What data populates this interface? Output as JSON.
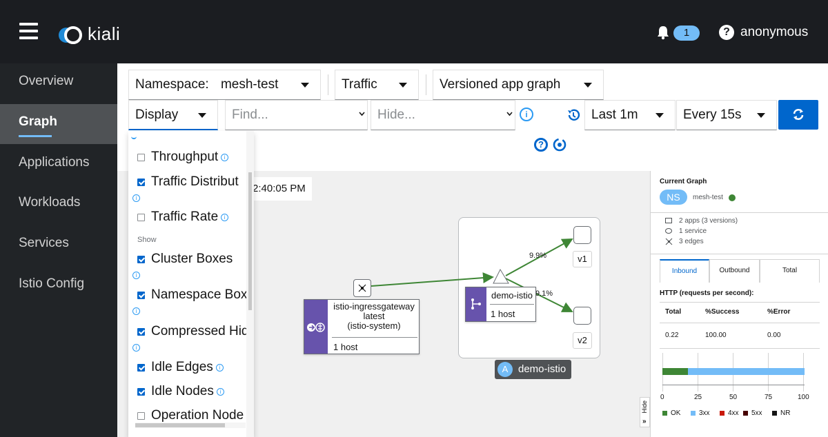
{
  "header": {
    "logo_text": "kiali",
    "notification_count": "1",
    "user": "anonymous",
    "help_glyph": "?"
  },
  "sidebar": {
    "items": [
      {
        "label": "Overview",
        "active": false
      },
      {
        "label": "Graph",
        "active": true
      },
      {
        "label": "Applications",
        "active": false
      },
      {
        "label": "Workloads",
        "active": false
      },
      {
        "label": "Services",
        "active": false
      },
      {
        "label": "Istio Config",
        "active": false
      }
    ]
  },
  "toolbar": {
    "namespace_label": "Namespace:",
    "namespace_value": "mesh-test",
    "edge_label_select": "Traffic",
    "graph_type": "Versioned app graph",
    "display_label": "Display",
    "find_placeholder": "Find...",
    "hide_placeholder": "Hide...",
    "duration": "Last 1m",
    "refresh_interval": "Every 15s"
  },
  "display_menu": {
    "items": [
      {
        "label": "Throughput",
        "checked": false,
        "info": true
      },
      {
        "label": "Traffic Distribut",
        "checked": true,
        "info": false
      },
      {
        "label": "Traffic Rate",
        "checked": false,
        "info": true
      },
      {
        "label": "Cluster Boxes",
        "checked": true,
        "info": false
      },
      {
        "label": "Namespace Box",
        "checked": true,
        "info": false
      },
      {
        "label": "Compressed Hid",
        "checked": true,
        "info": false
      },
      {
        "label": "Idle Edges",
        "checked": true,
        "info": true
      },
      {
        "label": "Idle Nodes",
        "checked": true,
        "info": true
      },
      {
        "label": "Operation Node",
        "checked": false,
        "info": false
      }
    ],
    "section_show": "Show"
  },
  "graph": {
    "timestamp": "2:40:05 PM",
    "gateway": {
      "name": "istio-ingressgateway",
      "version": "latest",
      "namespace": "(istio-system)",
      "hosts": "1 host"
    },
    "service": {
      "name": "demo-istio",
      "hosts": "1 host"
    },
    "app_label": "demo-istio",
    "app_badge": "A",
    "versions": [
      "v1",
      "v2"
    ],
    "edge_labels": {
      "v1": "9.9%",
      "v2": "9.1%"
    }
  },
  "panel": {
    "title": "Current Graph",
    "ns_badge": "NS",
    "namespace": "mesh-test",
    "stats": [
      "2 apps (3 versions)",
      "1 service",
      "3 edges"
    ],
    "tabs": [
      "Inbound",
      "Outbound",
      "Total"
    ],
    "http_title": "HTTP (requests per second):",
    "table_headers": [
      "Total",
      "%Success",
      "%Error"
    ],
    "table_values": [
      "0.22",
      "100.00",
      "0.00"
    ],
    "chart_ticks": [
      "0",
      "25",
      "50",
      "75",
      "100"
    ],
    "ok_pct": 18,
    "legend": [
      {
        "label": "OK",
        "color": "#3e8635"
      },
      {
        "label": "3xx",
        "color": "#73bcf7"
      },
      {
        "label": "4xx",
        "color": "#c9190b"
      },
      {
        "label": "5xx",
        "color": "#470000"
      },
      {
        "label": "NR",
        "color": "#151515"
      }
    ],
    "hide_label": "Hide"
  }
}
